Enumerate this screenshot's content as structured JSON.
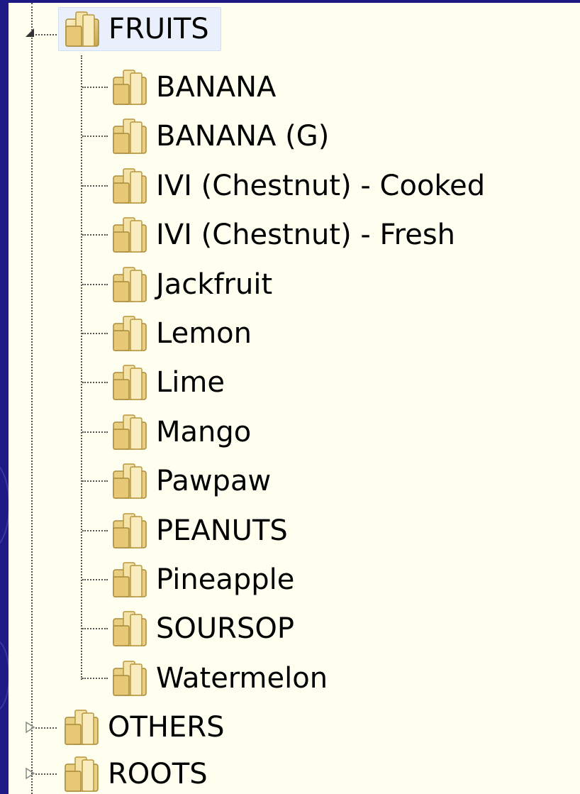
{
  "tree": {
    "fruits": {
      "label": "FRUITS",
      "expanded": true,
      "icon": "folder-icon",
      "children": [
        "BANANA",
        "BANANA (G)",
        "IVI (Chestnut) - Cooked",
        "IVI (Chestnut) - Fresh",
        "Jackfruit",
        "Lemon",
        "Lime",
        "Mango",
        "Pawpaw",
        "PEANUTS",
        "Pineapple",
        "SOURSOP",
        "Watermelon"
      ]
    },
    "others": {
      "label": "OTHERS",
      "expanded": false,
      "icon": "folder-icon"
    },
    "roots": {
      "label": "ROOTS",
      "expanded": false,
      "icon": "folder-icon"
    }
  },
  "colors": {
    "background": "#1e1b86",
    "panel": "#fffff0",
    "selection": "#e9f0fb"
  }
}
